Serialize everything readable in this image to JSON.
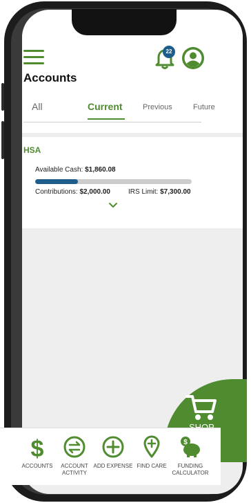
{
  "header": {
    "title": "Accounts",
    "notification_count": "22"
  },
  "tabs": [
    {
      "label": "All"
    },
    {
      "label": "Current"
    },
    {
      "label": "Previous"
    },
    {
      "label": "Future"
    }
  ],
  "account": {
    "name": "HSA",
    "available_cash_label": "Available Cash:",
    "available_cash": "$1,860.08",
    "contributions_label": "Contributions:",
    "contributions": "$2,000.00",
    "irs_limit_label": "IRS Limit:",
    "irs_limit": "$7,300.00",
    "progress_fraction": 0.274
  },
  "shop": {
    "label": "SHOP"
  },
  "bottom_nav": [
    {
      "label": "ACCOUNTS",
      "icon": "dollar-icon"
    },
    {
      "label": "ACCOUNT ACTIVITY",
      "icon": "transfer-icon"
    },
    {
      "label": "ADD EXPENSE",
      "icon": "plus-circle-icon"
    },
    {
      "label": "FIND CARE",
      "icon": "map-pin-plus-icon"
    },
    {
      "label": "FUNDING CALCULATOR",
      "icon": "piggy-bank-icon"
    }
  ],
  "colors": {
    "brand_green": "#4f8b2f",
    "progress_blue": "#1d5c8b",
    "background_gray": "#eeeeee"
  }
}
